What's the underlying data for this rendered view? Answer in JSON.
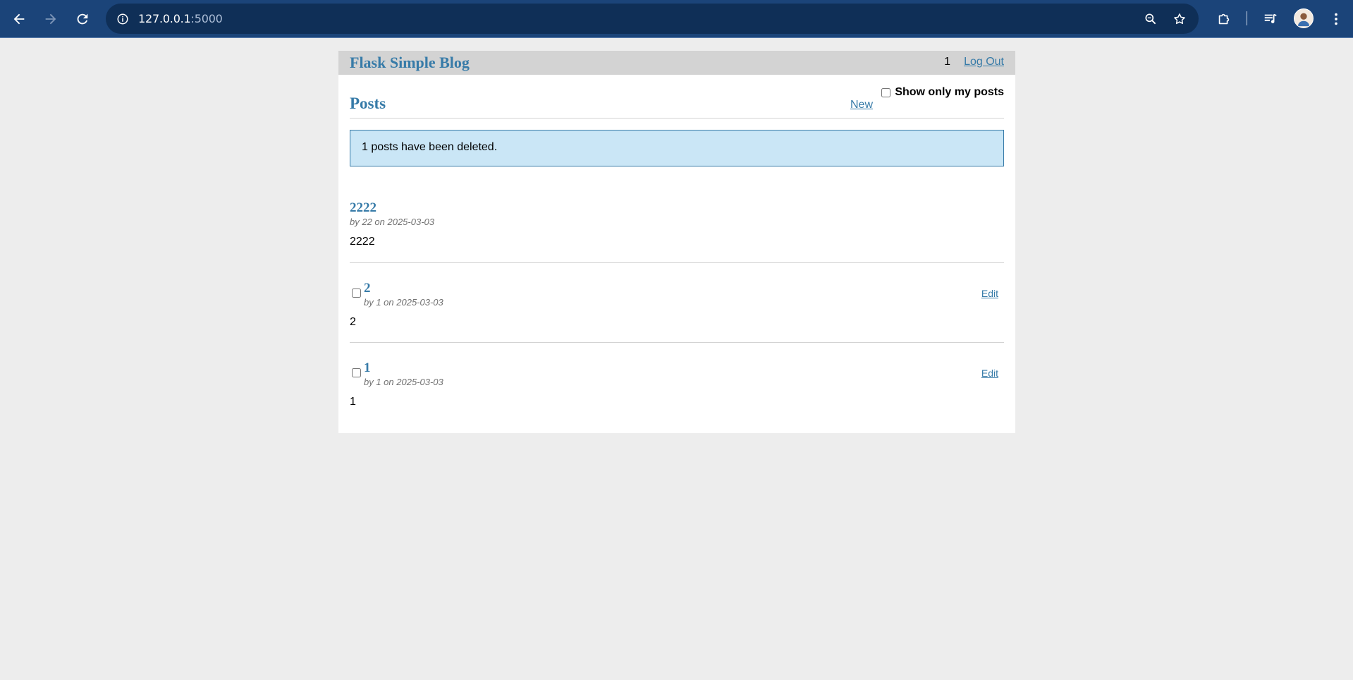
{
  "browser": {
    "url_host": "127.0.0.1",
    "url_port": ":5000",
    "icons": [
      "back-arrow-icon",
      "forward-arrow-icon",
      "reload-icon",
      "info-icon",
      "zoom-icon",
      "star-icon",
      "extensions-icon",
      "media-icon",
      "avatar",
      "menu-icon"
    ],
    "theme_color": "#1b4479"
  },
  "header": {
    "site_title": "Flask Simple Blog",
    "username": "1",
    "logout_label": "Log Out"
  },
  "posts_section": {
    "title": "Posts",
    "new_label": "New",
    "filter_label": "Show only my posts",
    "filter_checked": false
  },
  "flash": {
    "message": "1 posts have been deleted."
  },
  "posts": [
    {
      "title": "2222",
      "meta": "by 22 on 2025-03-03",
      "body": "2222",
      "selectable": false,
      "editable": false
    },
    {
      "title": "2",
      "meta": "by 1 on 2025-03-03",
      "body": "2",
      "selectable": true,
      "editable": true,
      "edit_label": "Edit"
    },
    {
      "title": "1",
      "meta": "by 1 on 2025-03-03",
      "body": "1",
      "selectable": true,
      "editable": true,
      "edit_label": "Edit"
    }
  ],
  "colors": {
    "link": "#377ba8",
    "header_bg": "#d3d3d3",
    "flash_bg": "#cae6f6",
    "page_bg": "#ededed"
  }
}
